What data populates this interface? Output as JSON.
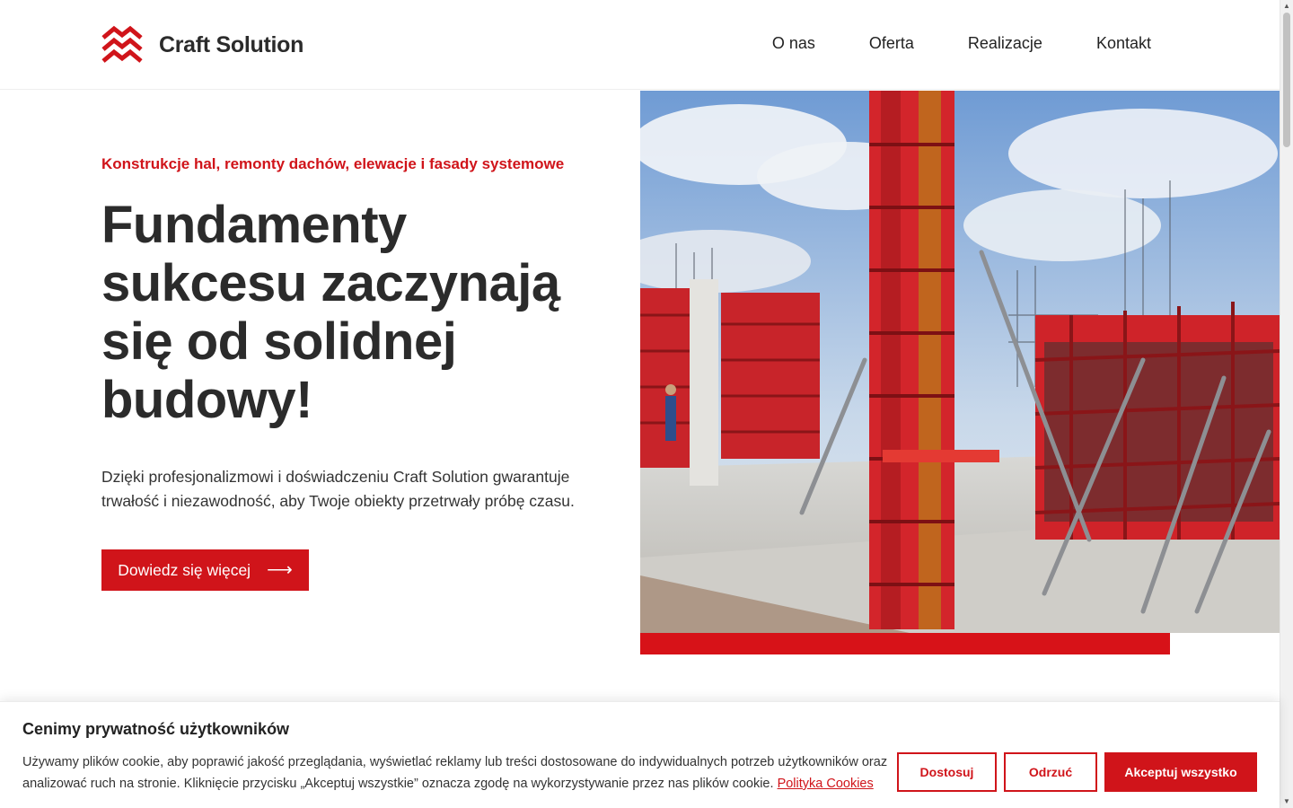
{
  "brand": {
    "name": "Craft Solution",
    "accent_color": "#d0141a"
  },
  "nav": {
    "items": [
      {
        "label": "O nas"
      },
      {
        "label": "Oferta"
      },
      {
        "label": "Realizacje"
      },
      {
        "label": "Kontakt"
      }
    ]
  },
  "hero": {
    "subheading": "Konstrukcje hal, remonty dachów, elewacje i fasady systemowe",
    "title": "Fundamenty sukcesu zaczynają się od solidnej budowy!",
    "description": "Dzięki profesjonalizmowi i doświadczeniu Craft Solution gwarantuje trwałość i niezawodność, aby Twoje obiekty przetrwały próbę czasu.",
    "cta_label": "Dowiedz się więcej",
    "cta_icon": "arrow-right-icon",
    "image_icon": "construction-site-photo"
  },
  "cookie_banner": {
    "title": "Cenimy prywatność użytkowników",
    "text": "Używamy plików cookie, aby poprawić jakość przeglądania, wyświetlać reklamy lub treści dostosowane do indywidualnych potrzeb użytkowników oraz analizować ruch na stronie. Kliknięcie przycisku „Akceptuj wszystkie” oznacza zgodę na wykorzystywanie przez nas plików cookie.",
    "policy_link": "Polityka Cookies",
    "customize_label": "Dostosuj",
    "reject_label": "Odrzuć",
    "accept_label": "Akceptuj wszystko"
  }
}
